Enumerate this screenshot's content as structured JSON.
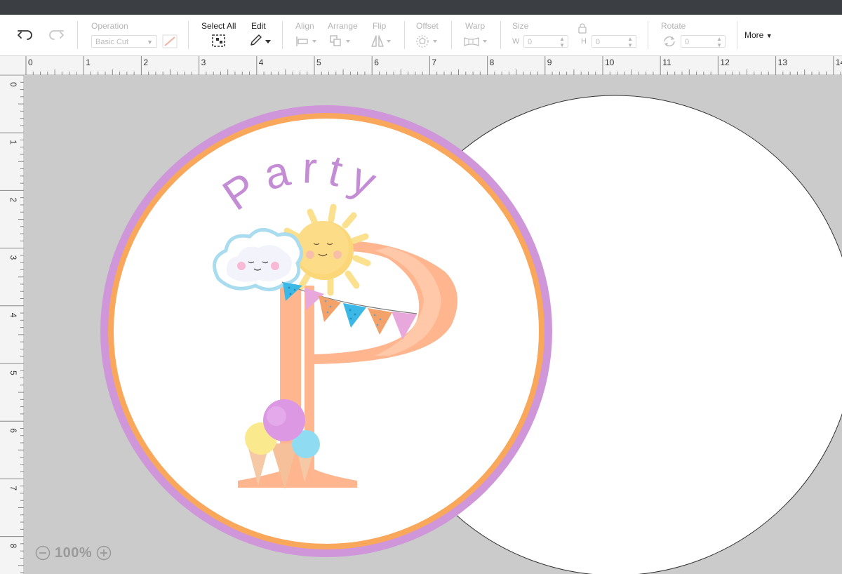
{
  "toolbar": {
    "operation": {
      "label": "Operation",
      "value": "Basic Cut"
    },
    "select_all": "Select All",
    "edit": "Edit",
    "align": "Align",
    "arrange": "Arrange",
    "flip": "Flip",
    "offset": "Offset",
    "warp": "Warp",
    "size": {
      "label": "Size",
      "w_label": "W",
      "h_label": "H",
      "w_value": "0",
      "h_value": "0"
    },
    "rotate": {
      "label": "Rotate",
      "value": "0"
    },
    "more": "More"
  },
  "ruler": {
    "top": [
      "0",
      "1",
      "2",
      "3",
      "4",
      "5",
      "6",
      "7",
      "8",
      "9",
      "10",
      "11",
      "12",
      "13",
      "14"
    ],
    "left": [
      "0",
      "1",
      "2",
      "3",
      "4",
      "5",
      "6",
      "7",
      "8"
    ]
  },
  "design": {
    "party_text": "Party"
  },
  "zoom": {
    "level": "100%"
  },
  "colors": {
    "purple_ring": "#cf96d9",
    "orange_ring": "#f9a85b",
    "letter_peach": "#ffb58e",
    "party_text": "#c58cd6",
    "topbar": "#3b3f43"
  }
}
